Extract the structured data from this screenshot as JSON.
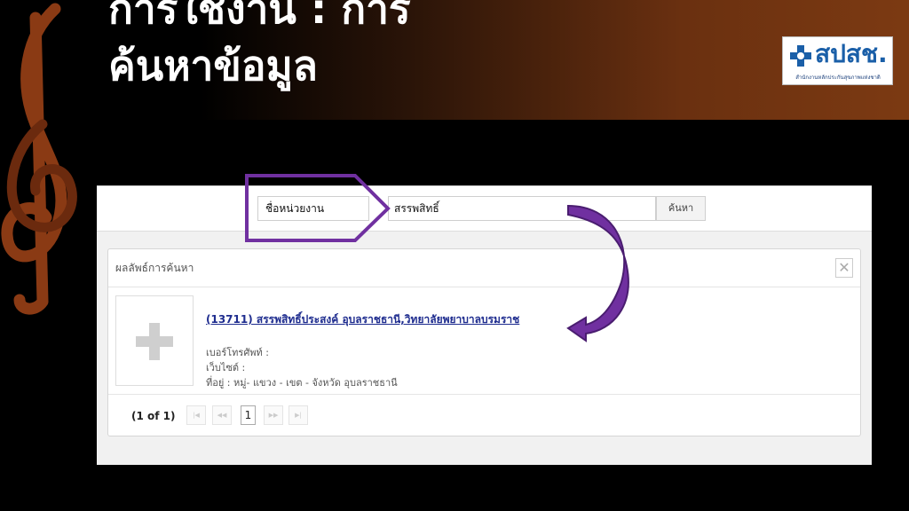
{
  "slide": {
    "title_line1": "การใช้งาน : การ",
    "title_line2": "ค้นหาข้อมูล"
  },
  "logo": {
    "text": "สปสช.",
    "subtitle": "สำนักงานหลักประกันสุขภาพแห่งชาติ",
    "icon": "medical-cross-icon"
  },
  "search": {
    "field_label": "ชื่อหน่วยงาน",
    "query_value": "สรรพสิทธิ์",
    "button_label": "ค้นหา"
  },
  "results": {
    "title": "ผลลัพธ์การค้นหา",
    "close_icon": "close-icon",
    "items": [
      {
        "name": "(13711) สรรพสิทธิ์ประสงค์ อุบลราชธานี,วิทยาลัยพยาบาลบรมราช",
        "phone": "เบอร์โทรศัพท์ :",
        "website": "เว็บไซต์ :",
        "address": "ที่อยู่ : หมู่- แขวง - เขต - จังหวัด อุบลราชธานี"
      }
    ]
  },
  "pager": {
    "info": "(1 of 1)",
    "first": "|◀",
    "prev": "◀◀",
    "current": "1",
    "next": "▶▶",
    "last": "▶|"
  },
  "colors": {
    "highlight": "#7030a0",
    "link": "#1f2d8f",
    "logo_blue": "#1a5fa8"
  }
}
